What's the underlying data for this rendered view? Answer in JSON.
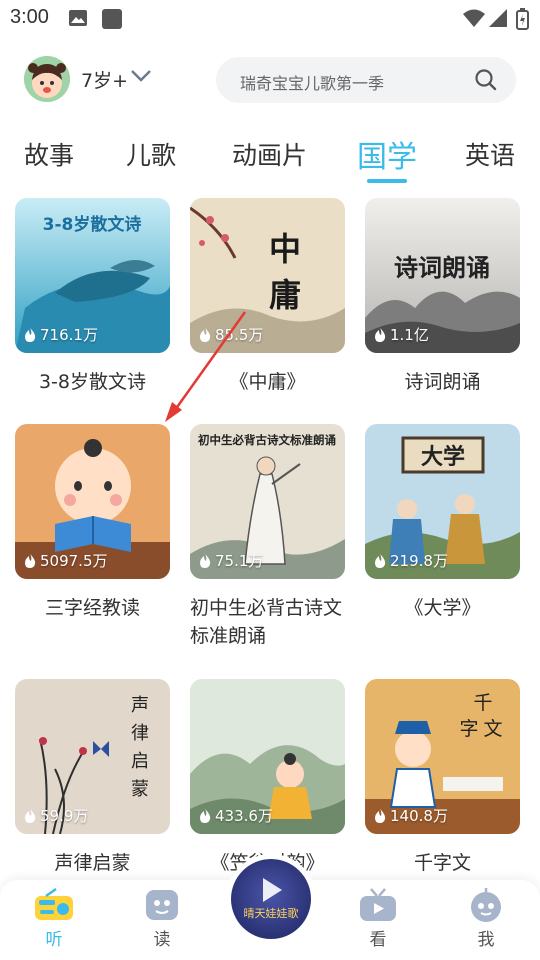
{
  "status_bar": {
    "time": "3:00"
  },
  "header": {
    "age": "7岁+",
    "search_placeholder": "瑞奇宝宝儿歌第一季"
  },
  "tabs": [
    {
      "label": "故事"
    },
    {
      "label": "儿歌"
    },
    {
      "label": "动画片"
    },
    {
      "label": "国学",
      "active": true
    },
    {
      "label": "英语"
    }
  ],
  "cards": [
    {
      "title": "3-8岁散文诗",
      "count": "716.1万",
      "cover_text": "3-8岁散文诗"
    },
    {
      "title": "《中庸》",
      "count": "85.5万",
      "cover_text": "中庸"
    },
    {
      "title": "诗词朗诵",
      "count": "1.1亿",
      "cover_text": "诗词朗诵"
    },
    {
      "title": "三字经教读",
      "count": "5097.5万"
    },
    {
      "title": "初中生必背古诗文标准朗诵",
      "count": "75.1万",
      "cover_text": "初中生必背古诗文标准朗诵"
    },
    {
      "title": "《大学》",
      "count": "219.8万",
      "cover_text": "大学"
    },
    {
      "title": "声律启蒙",
      "count": "59.9万",
      "cover_text": "声律启蒙"
    },
    {
      "title": "《笠翁对韵》",
      "count": "433.6万"
    },
    {
      "title": "千字文",
      "count": "140.8万",
      "cover_text": "千字文"
    }
  ],
  "bottom_nav": [
    {
      "label": "听",
      "active": true
    },
    {
      "label": "读"
    },
    {
      "label": "看"
    },
    {
      "label": "我"
    }
  ],
  "now_playing": {
    "cover_text": "晴天娃娃歌"
  },
  "colors": {
    "accent": "#3bbbe9",
    "annotation_arrow": "#e53935"
  }
}
